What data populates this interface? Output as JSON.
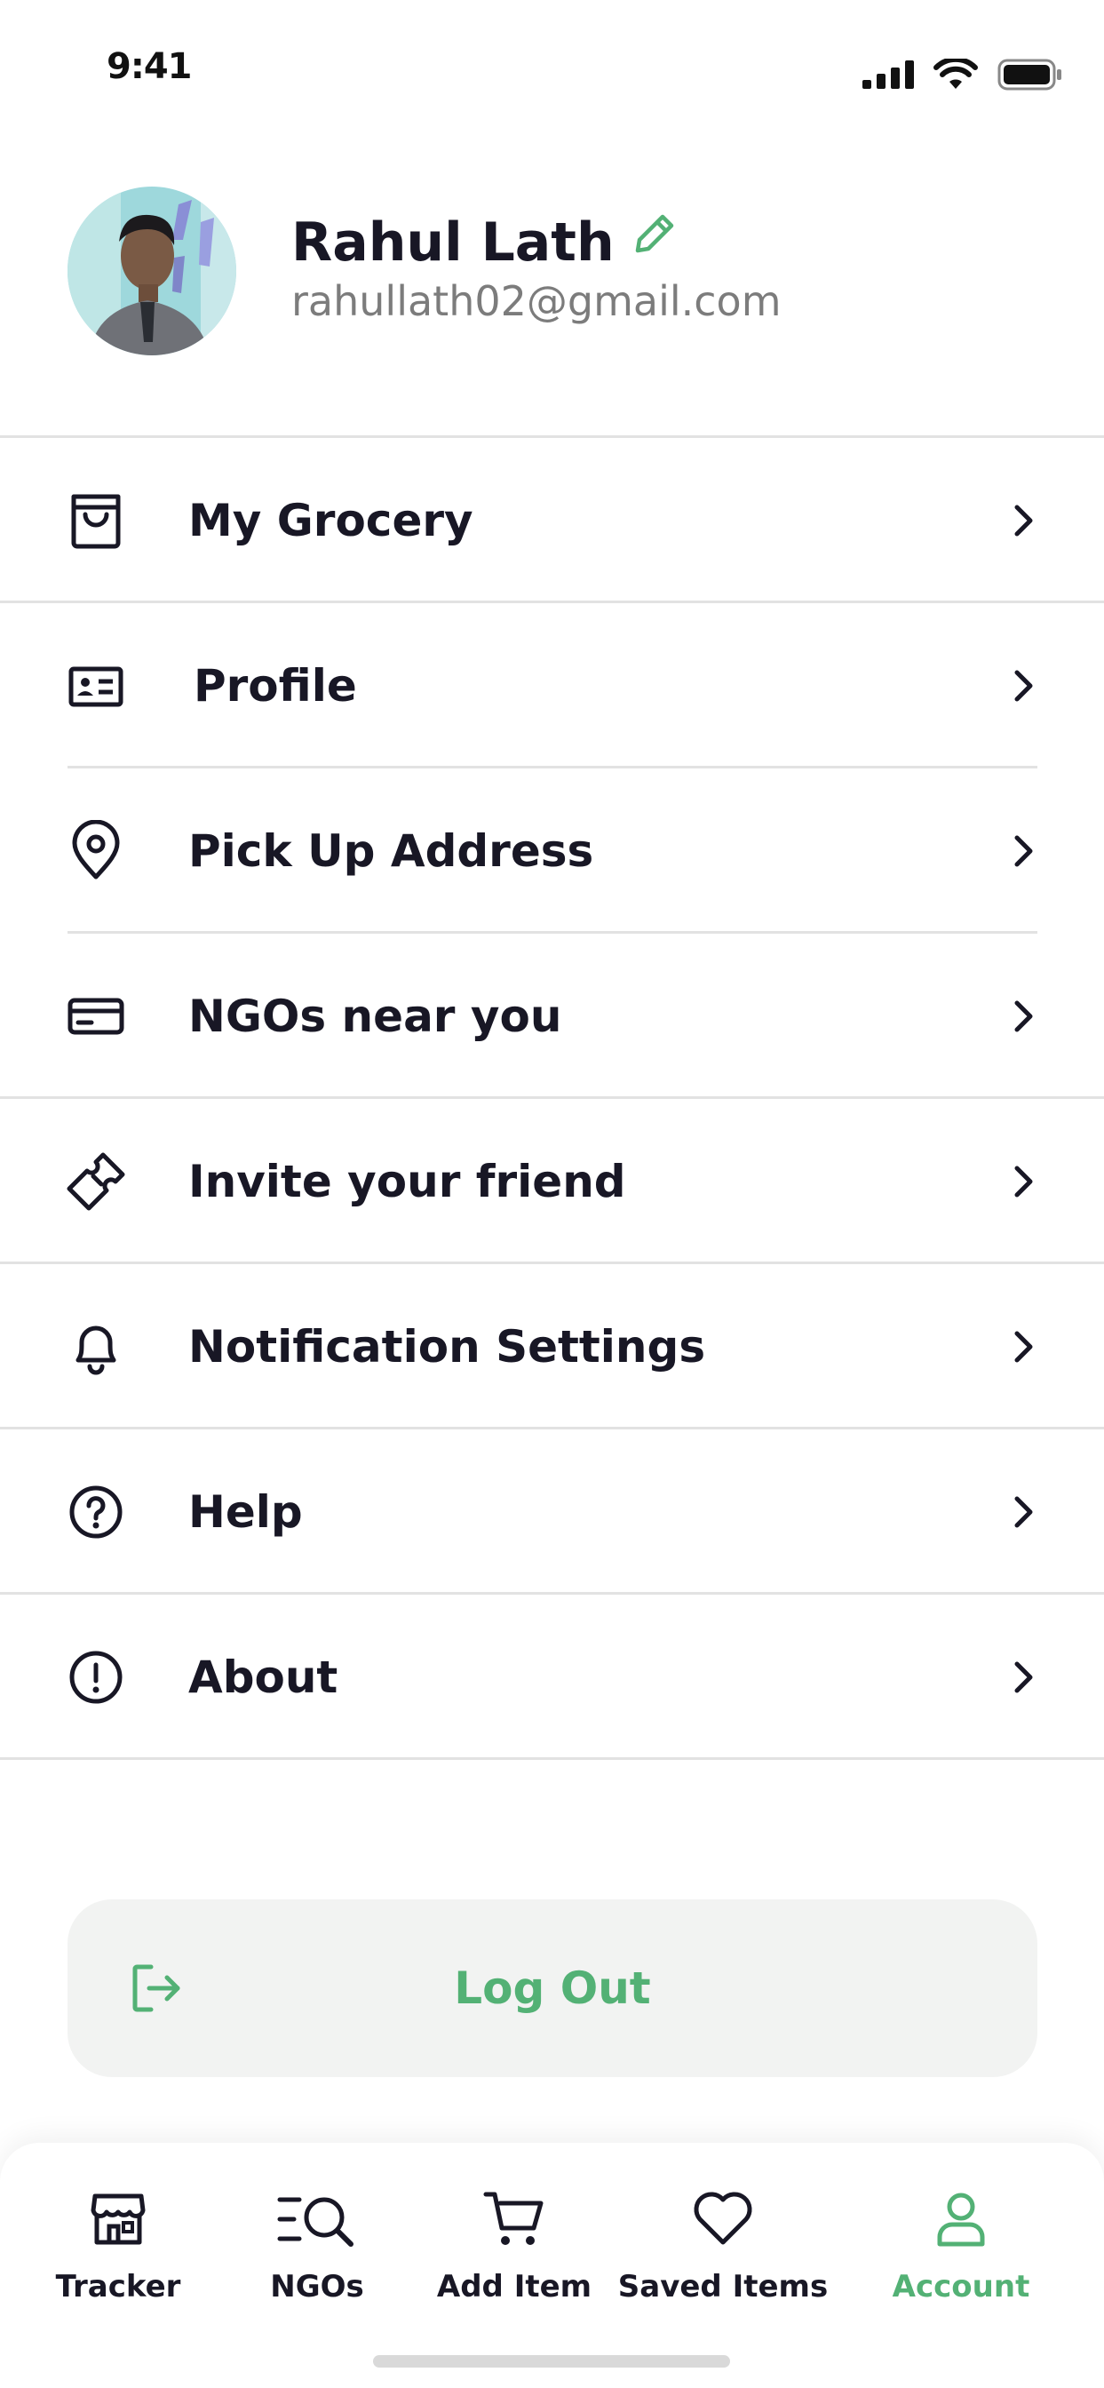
{
  "status_bar": {
    "time": "9:41"
  },
  "profile": {
    "name": "Rahul Lath",
    "email": "rahullath02@gmail.com"
  },
  "menu": {
    "items": [
      {
        "label": "My Grocery",
        "icon": "shopping-bag-icon"
      },
      {
        "label": "Profile",
        "icon": "id-card-icon"
      },
      {
        "label": "Pick Up Address",
        "icon": "location-pin-icon"
      },
      {
        "label": "NGOs near you",
        "icon": "card-icon"
      },
      {
        "label": "Invite your friend",
        "icon": "ticket-icon"
      },
      {
        "label": "Notification Settings",
        "icon": "bell-icon"
      },
      {
        "label": "Help",
        "icon": "help-circle-icon"
      },
      {
        "label": "About",
        "icon": "info-circle-icon"
      }
    ]
  },
  "logout": {
    "label": "Log Out"
  },
  "bottom_nav": {
    "items": [
      {
        "label": "Tracker",
        "icon": "store-icon"
      },
      {
        "label": "NGOs",
        "icon": "search-list-icon"
      },
      {
        "label": "Add Item",
        "icon": "cart-icon"
      },
      {
        "label": "Saved Items",
        "icon": "heart-icon"
      },
      {
        "label": "Account",
        "icon": "user-icon"
      }
    ],
    "active": "Account"
  },
  "colors": {
    "accent": "#53b175",
    "text": "#181725",
    "muted": "#7c7c7c",
    "divider": "#e2e2e2",
    "button_bg": "#f2f3f2"
  }
}
